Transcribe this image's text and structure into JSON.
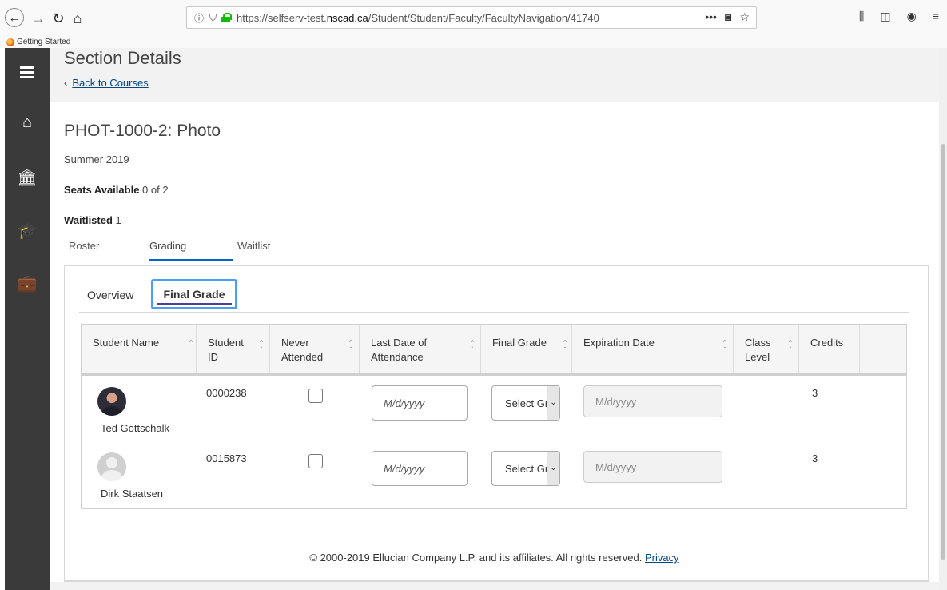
{
  "browser": {
    "url_prefix": "https://selfserv-test.",
    "url_domain": "nscad.ca",
    "url_path": "/Student/Student/Faculty/FacultyNavigation/41740",
    "bookmark": "Getting Started"
  },
  "page": {
    "header": "Section Details",
    "back_link": "Back to Courses",
    "course_title": "PHOT-1000-2: Photo",
    "term": "Summer 2019",
    "seats_label": "Seats Available",
    "seats_value": "0 of 2",
    "waitlisted_label": "Waitlisted",
    "waitlisted_value": "1"
  },
  "tabs": [
    {
      "label": "Roster"
    },
    {
      "label": "Grading"
    },
    {
      "label": "Waitlist"
    }
  ],
  "subtabs": [
    {
      "label": "Overview"
    },
    {
      "label": "Final Grade"
    }
  ],
  "columns": {
    "student_name": "Student Name",
    "student_id_1": "Student",
    "student_id_2": "ID",
    "never_1": "Never",
    "never_2": "Attended",
    "last_date_1": "Last Date of",
    "last_date_2": "Attendance",
    "final_grade": "Final Grade",
    "expiration": "Expiration Date",
    "class_1": "Class",
    "class_2": "Level",
    "credits": "Credits"
  },
  "rows": [
    {
      "name": "Ted Gottschalk",
      "id": "0000238",
      "date_placeholder": "M/d/yyyy",
      "grade_select": "Select Grade",
      "exp_placeholder": "M/d/yyyy",
      "credits": "3"
    },
    {
      "name": "Dirk Staatsen",
      "id": "0015873",
      "date_placeholder": "M/d/yyyy",
      "grade_select": "Select Grade",
      "exp_placeholder": "M/d/yyyy",
      "credits": "3"
    }
  ],
  "footer": {
    "text": "© 2000-2019 Ellucian Company L.P. and its affiliates. All rights reserved.",
    "privacy": "Privacy"
  },
  "colors": {
    "sidebar": "#3a3a3a",
    "accent": "#0066cc",
    "link": "#00468b",
    "focus": "#4a9ff5"
  }
}
